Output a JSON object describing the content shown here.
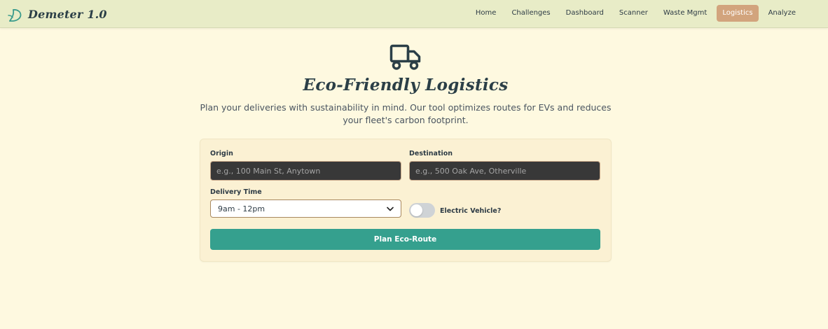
{
  "brand": {
    "name": "Demeter 1.0",
    "logo_icon": "leaf-d-logo-icon"
  },
  "nav": {
    "items": [
      {
        "label": "Home",
        "active": false
      },
      {
        "label": "Challenges",
        "active": false
      },
      {
        "label": "Dashboard",
        "active": false
      },
      {
        "label": "Scanner",
        "active": false
      },
      {
        "label": "Waste Mgmt",
        "active": false
      },
      {
        "label": "Logistics",
        "active": true
      },
      {
        "label": "Analyze",
        "active": false
      }
    ]
  },
  "hero": {
    "icon": "truck-icon",
    "title": "Eco-Friendly Logistics",
    "subtitle": "Plan your deliveries with sustainability in mind. Our tool optimizes routes for EVs and reduces your fleet's carbon footprint."
  },
  "form": {
    "origin": {
      "label": "Origin",
      "value": "",
      "placeholder": "e.g., 100 Main St, Anytown"
    },
    "destination": {
      "label": "Destination",
      "value": "",
      "placeholder": "e.g., 500 Oak Ave, Otherville"
    },
    "delivery_time": {
      "label": "Delivery Time",
      "selected": "9am - 12pm"
    },
    "electric_vehicle": {
      "label": "Electric Vehicle?",
      "checked": false
    },
    "submit_label": "Plan Eco-Route"
  },
  "colors": {
    "background": "#fef9e0",
    "navbar": "#e8ecc7",
    "active_nav": "#d2a47d",
    "primary_button": "#35a08e",
    "input_dark": "#383838",
    "text_dark": "#2b3f47"
  }
}
